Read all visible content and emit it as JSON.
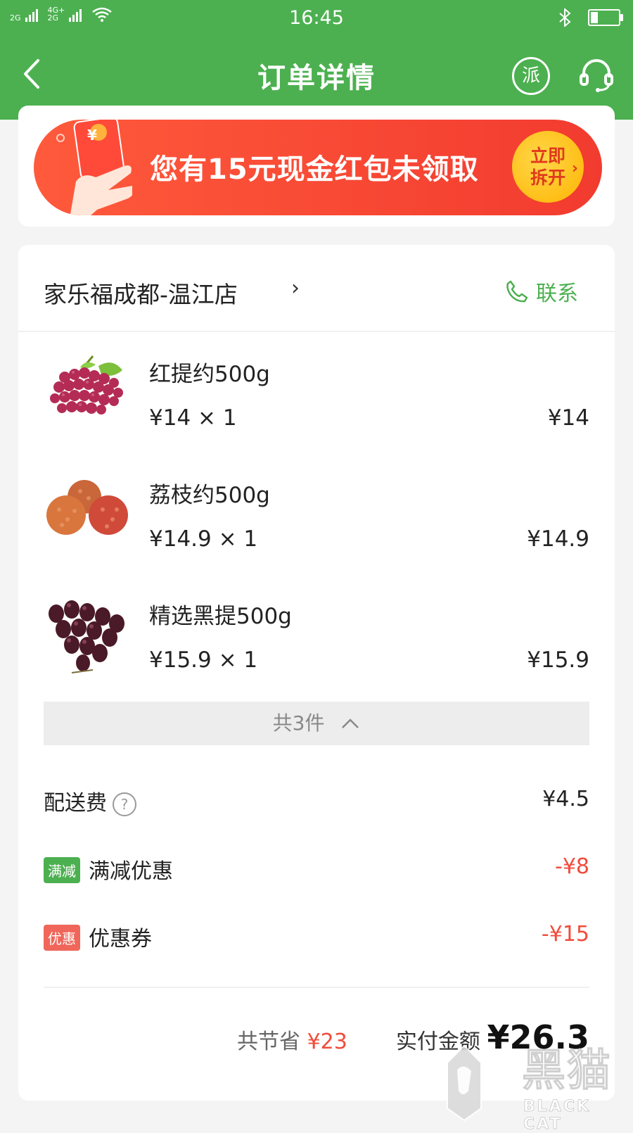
{
  "status_bar": {
    "time": "16:45",
    "network_1": "2G",
    "network_2": "4G+\n2G"
  },
  "nav": {
    "title": "订单详情",
    "dispatch_icon_text": "派"
  },
  "banner": {
    "text": "您有15元现金红包未领取",
    "button_line1": "立即",
    "button_line2": "拆开",
    "envelope_symbol": "¥"
  },
  "store": {
    "name": "家乐福成都-温江店",
    "contact_label": "联系"
  },
  "items": [
    {
      "name": "红提约500g",
      "unit_qty": "¥14 × 1",
      "total": "¥14"
    },
    {
      "name": "荔枝约500g",
      "unit_qty": "¥14.9 × 1",
      "total": "¥14.9"
    },
    {
      "name": "精选黑提500g",
      "unit_qty": "¥15.9 × 1",
      "total": "¥15.9"
    }
  ],
  "count_label": "共3件",
  "fees": {
    "delivery_label": "配送费",
    "delivery_value": "¥4.5",
    "full_reduction_tag": "满减",
    "full_reduction_label": "满减优惠",
    "full_reduction_value": "-¥8",
    "coupon_tag": "优惠",
    "coupon_label": "优惠券",
    "coupon_value": "-¥15"
  },
  "summary": {
    "saved_label": "共节省",
    "saved_value": "¥23",
    "paid_label": "实付金额",
    "paid_value": "¥26.3"
  },
  "watermark": {
    "text": "黑猫",
    "sub": "BLACK CAT"
  },
  "colors": {
    "primary": "#4cb050",
    "discount_red": "#f04c3c",
    "banner_red": "#f23b2f",
    "button_gold": "#ffc107",
    "full_tag_green": "#4cb050",
    "coupon_tag_red": "#f0665a"
  }
}
